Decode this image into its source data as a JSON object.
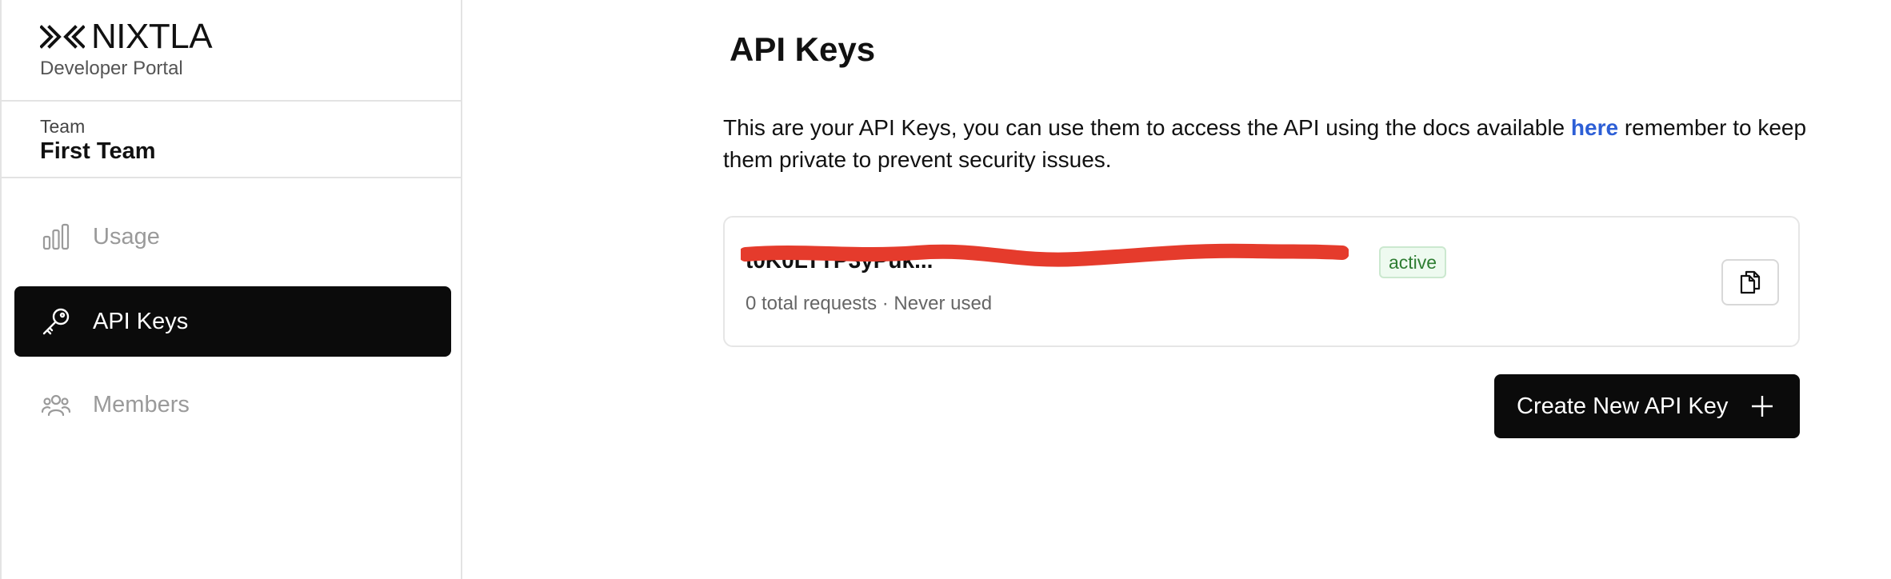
{
  "brand": {
    "name": "NIXTLA",
    "subtitle": "Developer Portal"
  },
  "team": {
    "label": "Team",
    "name": "First Team"
  },
  "sidebar": {
    "items": [
      {
        "label": "Usage",
        "icon": "bar-chart-icon",
        "active": false
      },
      {
        "label": "API Keys",
        "icon": "key-icon",
        "active": true
      },
      {
        "label": "Members",
        "icon": "users-icon",
        "active": false
      }
    ]
  },
  "main": {
    "title": "API Keys",
    "description_before": "This are your API Keys, you can use them to access the API using the docs available ",
    "description_link": "here",
    "description_after": " remember to keep them private to prevent security issues.",
    "keys": [
      {
        "value": "t0K0LTTP3yPuk...",
        "status": "active",
        "meta": "0 total requests · Never used"
      }
    ],
    "create_button_label": "Create New API Key"
  },
  "colors": {
    "accent_link": "#2d5fd6",
    "active_nav_bg": "#0b0b0b",
    "badge_green": "#2e7d32",
    "redaction": "#e53b2c"
  }
}
